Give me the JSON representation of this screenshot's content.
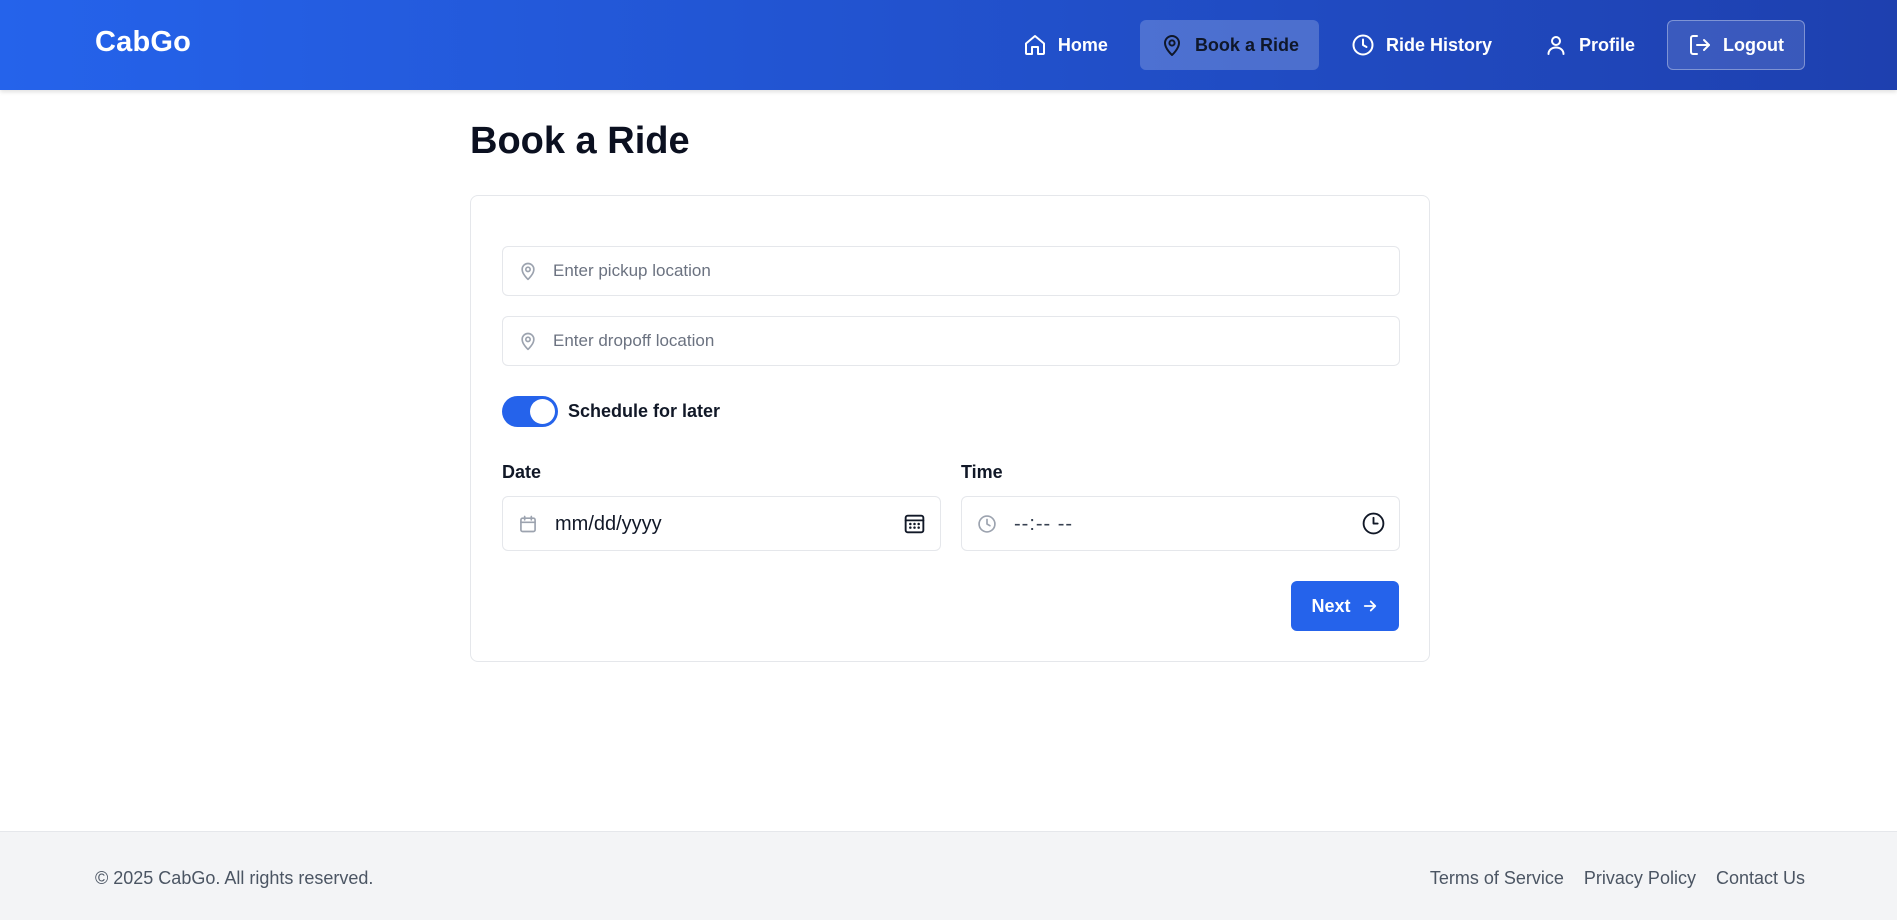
{
  "header": {
    "brand": "CabGo",
    "nav": [
      {
        "label": "Home",
        "icon": "home-icon"
      },
      {
        "label": "Book a Ride",
        "icon": "map-pin-icon",
        "active": true
      },
      {
        "label": "Ride History",
        "icon": "clock-icon"
      },
      {
        "label": "Profile",
        "icon": "user-icon"
      },
      {
        "label": "Logout",
        "icon": "logout-icon"
      }
    ]
  },
  "main": {
    "title": "Book a Ride",
    "pickup": {
      "placeholder": "Enter pickup location",
      "value": ""
    },
    "dropoff": {
      "placeholder": "Enter dropoff location",
      "value": ""
    },
    "schedule": {
      "label": "Schedule for later",
      "enabled": true
    },
    "date": {
      "label": "Date",
      "value": "mm/dd/yyyy"
    },
    "time": {
      "label": "Time",
      "value": "--:-- --"
    },
    "next_label": "Next"
  },
  "footer": {
    "copyright": "© 2025 CabGo. All rights reserved.",
    "links": [
      "Terms of Service",
      "Privacy Policy",
      "Contact Us"
    ]
  },
  "colors": {
    "primary": "#2563eb",
    "header_gradient_end": "#1e40af",
    "footer_bg": "#f3f4f6"
  }
}
